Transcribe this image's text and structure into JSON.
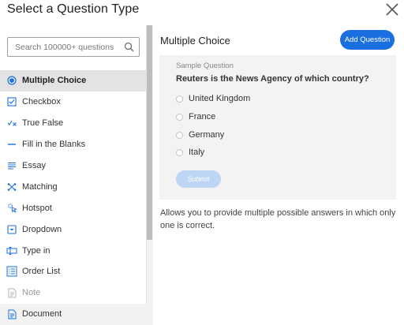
{
  "dialog": {
    "title": "Select a Question Type"
  },
  "search": {
    "placeholder": "Search 100000+ questions",
    "value": ""
  },
  "question_types": [
    {
      "label": "Multiple Choice",
      "icon": "radio-selected-icon",
      "active": true
    },
    {
      "label": "Checkbox",
      "icon": "checkbox-icon"
    },
    {
      "label": "True False",
      "icon": "check-cross-icon"
    },
    {
      "label": "Fill in the Blanks",
      "icon": "blank-line-icon"
    },
    {
      "label": "Essay",
      "icon": "text-lines-icon"
    },
    {
      "label": "Matching",
      "icon": "matching-icon"
    },
    {
      "label": "Hotspot",
      "icon": "hotspot-icon"
    },
    {
      "label": "Dropdown",
      "icon": "dropdown-icon"
    },
    {
      "label": "Type in",
      "icon": "type-in-icon"
    },
    {
      "label": "Order List",
      "icon": "order-list-icon"
    },
    {
      "label": "Note",
      "icon": "note-icon",
      "disabled": true
    },
    {
      "label": "Document",
      "icon": "document-icon"
    }
  ],
  "main": {
    "title": "Multiple Choice",
    "add_button": "Add Question",
    "sample_label": "Sample Question",
    "question": "Reuters is the News Agency of which country?",
    "options": [
      "United Kingdom",
      "France",
      "Germany",
      "Italy"
    ],
    "submit_button": "Submit",
    "description": "Allows you to provide multiple possible answers in which only one is correct."
  },
  "colors": {
    "accent": "#1a6fe0",
    "active_row": "#e3e3e3",
    "preview_bg": "#f3f3f3",
    "submit_disabled": "#bcd6f3"
  }
}
